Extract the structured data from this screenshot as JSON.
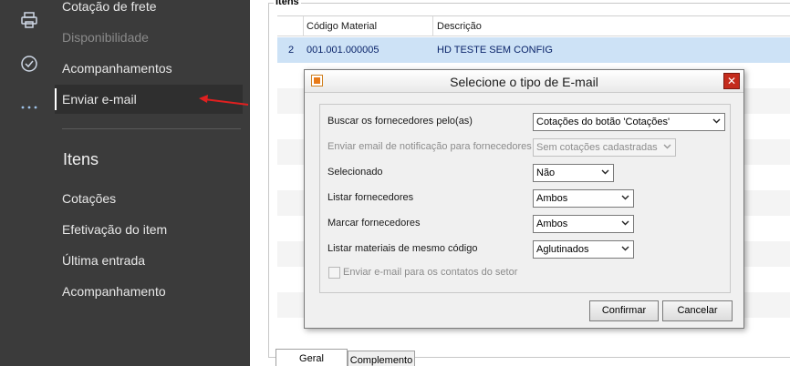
{
  "rail": {
    "icons": [
      "printer-icon",
      "check-circle-icon",
      "more-dots-icon"
    ]
  },
  "menu": {
    "items": [
      {
        "label": "Cotação de frete",
        "accel": "f"
      },
      {
        "label": "Disponibilidade",
        "accel": "D"
      },
      {
        "label": "Acompanhamentos",
        "accel": "A"
      },
      {
        "label": "Enviar e-mail",
        "accel": "n"
      }
    ],
    "section_title": "Itens",
    "section_items": [
      {
        "label": "Cotações",
        "accel": "C"
      },
      {
        "label": "Efetivação do item",
        "accel": "E"
      },
      {
        "label": "Última entrada",
        "accel": "Ú"
      },
      {
        "label": "Acompanhamento",
        "accel": "p"
      }
    ]
  },
  "items_panel": {
    "group_title": "Itens",
    "columns": [
      "Código Material",
      "Descrição"
    ],
    "rows": [
      {
        "num": "2",
        "code": "001.001.000005",
        "desc": "HD TESTE SEM CONFIG"
      }
    ],
    "tabs": [
      "Geral",
      "Complemento"
    ]
  },
  "dialog": {
    "title": "Selecione o tipo de E-mail",
    "close_label": "✕",
    "fields": [
      {
        "label": "Buscar os fornecedores pelo(as)",
        "value": "Cotações do botão 'Cotações'",
        "enabled": true
      },
      {
        "label": "Enviar email de notificação para fornecedores",
        "value": "Sem cotações cadastradas",
        "enabled": false
      },
      {
        "label": "Selecionado",
        "value": "Não",
        "enabled": true
      },
      {
        "label": "Listar fornecedores",
        "value": "Ambos",
        "enabled": true
      },
      {
        "label": "Marcar fornecedores",
        "value": "Ambos",
        "enabled": true
      },
      {
        "label": "Listar materiais de mesmo código",
        "value": "Aglutinados",
        "enabled": true
      }
    ],
    "checkbox_label": "Enviar e-mail para os contatos do setor",
    "checkbox_checked": false,
    "confirm_label": "Confirmar",
    "cancel_label": "Cancelar"
  },
  "colors": {
    "sidebar_bg": "#3b3b3b",
    "selection": "#cde2f6",
    "close_red": "#c42b1c",
    "annotation_arrow": "#e02020"
  }
}
